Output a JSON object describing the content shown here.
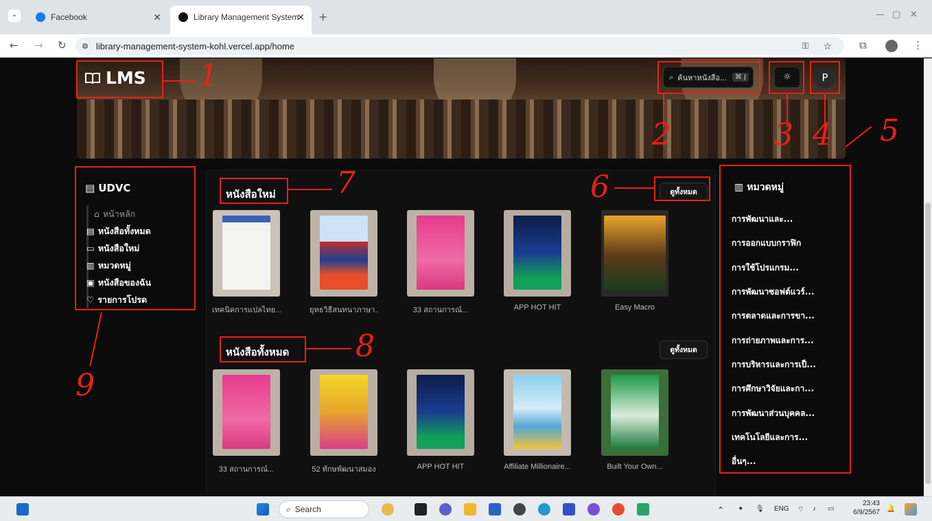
{
  "browser": {
    "tabs": [
      {
        "title": "Facebook"
      },
      {
        "title": "Library Management System"
      }
    ],
    "url": "library-management-system-kohl.vercel.app/home"
  },
  "header": {
    "logo": "LMS",
    "search_placeholder": "ค้นหาหนังสือ...",
    "search_shortcut": "⌘ J",
    "avatar_initial": "P"
  },
  "sidebar": {
    "title": "UDVC",
    "items": [
      {
        "label": "หน้าหลัก"
      },
      {
        "label": "หนังสือทั้งหมด"
      },
      {
        "label": "หนังสือใหม่"
      },
      {
        "label": "หมวดหมู่"
      },
      {
        "label": "หนังสือของฉัน"
      },
      {
        "label": "รายการโปรด"
      }
    ]
  },
  "new_books": {
    "title": "หนังสือใหม่",
    "view_all": "ดูทั้งหมด",
    "books": [
      {
        "title": "เทคนิคการแปลไทย..."
      },
      {
        "title": "ยุทธวิธีสนทนาภาษา..."
      },
      {
        "title": "33 สถานการณ์..."
      },
      {
        "title": "APP HOT HIT"
      },
      {
        "title": "Easy Macro"
      }
    ]
  },
  "all_books": {
    "title": "หนังสือทั้งหมด",
    "view_all": "ดูทั้งหมด",
    "books": [
      {
        "title": "33 สถานการณ์..."
      },
      {
        "title": "52 ทักษพัฒนาสมอง"
      },
      {
        "title": "APP HOT HIT"
      },
      {
        "title": "Affiliate Millionaire..."
      },
      {
        "title": "Built Your Own..."
      }
    ]
  },
  "categories": {
    "title": "หมวดหมู่",
    "items": [
      "การพัฒนาและ...",
      "การออกแบบกราฟิก",
      "การใช้โปรแกรม...",
      "การพัฒนาซอฟต์แวร์...",
      "การตลาดและการขา...",
      "การถ่ายภาพและการ...",
      "การบริหารและการเป็...",
      "การศึกษาวิจัยและกา...",
      "การพัฒนาส่วนบุคคล...",
      "เทคโนโลยีและการ...",
      "อื่นๆ..."
    ]
  },
  "annotations": [
    "1",
    "2",
    "3",
    "4",
    "5",
    "6",
    "7",
    "8",
    "9"
  ],
  "taskbar": {
    "search": "Search",
    "lang": "ENG",
    "time": "23:43",
    "date": "6/9/2567"
  },
  "colors": {
    "annotation": "#e8201d",
    "background": "#0b0b0b"
  }
}
